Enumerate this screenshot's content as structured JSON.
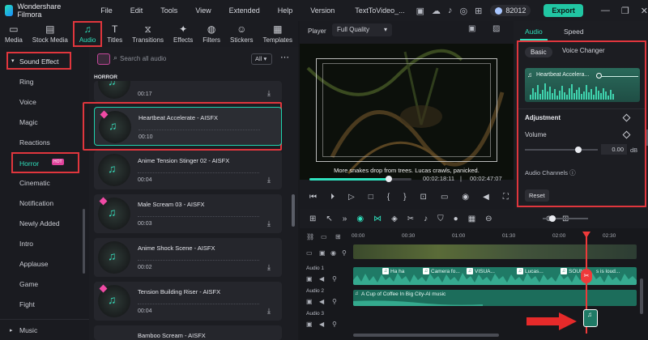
{
  "app": {
    "name": "Wondershare Filmora",
    "project": "TextToVideo_...",
    "credits": "82012",
    "export_label": "Export"
  },
  "menu": [
    "File",
    "Edit",
    "Tools",
    "View",
    "Extended",
    "Help",
    "Version"
  ],
  "tools": [
    "Media",
    "Stock Media",
    "Audio",
    "Titles",
    "Transitions",
    "Effects",
    "Filters",
    "Stickers",
    "Templates"
  ],
  "sidebar": {
    "header": "Sound Effect",
    "items": [
      "Ring",
      "Voice",
      "Magic",
      "Reactions",
      "Horror",
      "Cinematic",
      "Notification",
      "Newly Added",
      "Intro",
      "Applause",
      "Game",
      "Fight"
    ],
    "hot_badge": "HOT",
    "footer": "Music"
  },
  "list": {
    "search_placeholder": "Search all audio",
    "filter": "All",
    "section": "HORROR",
    "items": [
      {
        "title": "",
        "duration": "00:17"
      },
      {
        "title": "Heartbeat Accelerate - AISFX",
        "duration": "00:10"
      },
      {
        "title": "Anime Tension Stinger 02 - AISFX",
        "duration": "00:04"
      },
      {
        "title": "Male Scream 03 - AISFX",
        "duration": "00:03"
      },
      {
        "title": "Anime Shock Scene - AISFX",
        "duration": "00:02"
      },
      {
        "title": "Tension Building Riser - AISFX",
        "duration": "00:04"
      },
      {
        "title": "Bamboo Scream - AISFX",
        "duration": ""
      }
    ]
  },
  "player": {
    "label": "Player",
    "quality": "Full Quality",
    "subtitle": "More snakes drop from trees. Lucas crawls, panicked.",
    "current_time": "00:02:18:11",
    "total_time": "00:02:47:07",
    "progress": 0.78
  },
  "props": {
    "tabs": [
      "Audio",
      "Speed"
    ],
    "subtabs": [
      "Basic",
      "Voice Changer"
    ],
    "clip_title": "Heartbeat Accelera...",
    "adjustment": "Adjustment",
    "volume_label": "Volume",
    "volume_value": "0.00",
    "volume_unit": "dB",
    "channels_label": "Audio Channels",
    "reset_label": "Reset"
  },
  "timeline": {
    "ruler": [
      "00:00",
      "00:30",
      "01:00",
      "01:30",
      "02:00",
      "02:30"
    ],
    "tracks": [
      "Audio 1",
      "Audio 2",
      "Audio 3"
    ],
    "audio1_labels": [
      "Ha ha",
      "Camera fo...",
      "VISUA...",
      "Lucas...",
      "SOUND",
      "s is loud..."
    ],
    "audio2_label": "A Cup of Coffee In Big City-AI music"
  }
}
